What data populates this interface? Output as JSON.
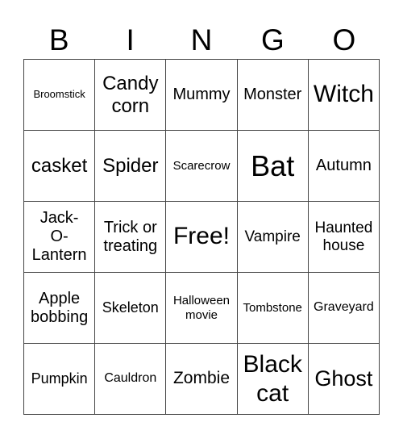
{
  "header": [
    "B",
    "I",
    "N",
    "G",
    "O"
  ],
  "cells": [
    [
      "Broomstick",
      "Candy corn",
      "Mummy",
      "Monster",
      "Witch"
    ],
    [
      "casket",
      "Spider",
      "Scarecrow",
      "Bat",
      "Autumn"
    ],
    [
      "Jack-O-Lantern",
      "Trick or treating",
      "Free!",
      "Vampire",
      "Haunted house"
    ],
    [
      "Apple bobbing",
      "Skeleton",
      "Halloween movie",
      "Tombstone",
      "Graveyard"
    ],
    [
      "Pumpkin",
      "Cauldron",
      "Zombie",
      "Black cat",
      "Ghost"
    ]
  ]
}
